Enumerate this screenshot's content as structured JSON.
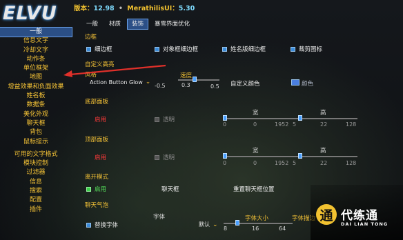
{
  "header": {
    "logo": "ELVU",
    "version_label": "版本：",
    "version_number": "12.98",
    "plugin_label": "MerathilisUI：",
    "plugin_version": "5.30",
    "separator": "•"
  },
  "sidebar": {
    "items": [
      {
        "label": "一般",
        "active": true
      },
      {
        "label": "信息文字"
      },
      {
        "label": "冷却文字"
      },
      {
        "label": "动作条"
      },
      {
        "label": "单位框架"
      },
      {
        "label": "地图"
      },
      {
        "label": "增益效果和负面效果"
      },
      {
        "label": "姓名板"
      },
      {
        "label": "数据条"
      },
      {
        "label": "美化外观"
      },
      {
        "label": "聊天框"
      },
      {
        "label": "背包"
      },
      {
        "label": "鼠标提示"
      }
    ],
    "items2": [
      {
        "label": "可用的文字格式"
      },
      {
        "label": "模块控制"
      },
      {
        "label": "过滤器"
      },
      {
        "label": "信息"
      },
      {
        "label": "搜索"
      },
      {
        "label": "配置"
      },
      {
        "label": "插件"
      }
    ]
  },
  "tabs": [
    {
      "label": "一般"
    },
    {
      "label": "材质"
    },
    {
      "label": "装饰",
      "active": true
    },
    {
      "label": "暴雪界面优化"
    }
  ],
  "border": {
    "title": "边框",
    "options": [
      "细边框",
      "对象框细边框",
      "姓名版细边框",
      "裁剪图标"
    ]
  },
  "highlight": {
    "title": "自定义高亮",
    "style_label": "风格",
    "style_value": "Action Button Glow",
    "style_num": "-0.5",
    "speed_label": "速度",
    "speed_value": "0.3",
    "speed_end": "0.5",
    "custom_color_label": "自定义颜色",
    "color_label": "颜色"
  },
  "bottom_panel": {
    "title": "底部面板",
    "enable": "启用",
    "transparent": "透明",
    "width_label": "宽",
    "width_min": "0",
    "width_value": "0",
    "width_max": "1952",
    "height_label": "高",
    "height_min": "5",
    "height_value": "22",
    "height_max": "128"
  },
  "top_panel": {
    "title": "顶部面板",
    "enable": "启用",
    "transparent": "透明",
    "width_label": "宽",
    "width_min": "0",
    "width_value": "0",
    "width_max": "1952",
    "height_label": "高",
    "height_min": "5",
    "height_value": "22",
    "height_max": "128"
  },
  "afk": {
    "title": "离开模式",
    "enable": "启用",
    "chat_label": "聊天框",
    "reset_chat": "重置聊天框位置"
  },
  "chat_bubble": {
    "title": "聊天气泡",
    "replace_font": "替换字体",
    "font_label": "字体",
    "font_value": "默认",
    "font_size_label": "字体大小",
    "font_size_min": "8",
    "font_size_value": "16",
    "font_size_max": "64",
    "outline_label": "字体描边"
  },
  "watermark": {
    "cn": "代练通",
    "en": "DAI LIAN TONG",
    "glyph": "通"
  },
  "colors": {
    "accent": "#2b4f86",
    "gold": "#f4c236",
    "arrow": "#e0302a"
  }
}
